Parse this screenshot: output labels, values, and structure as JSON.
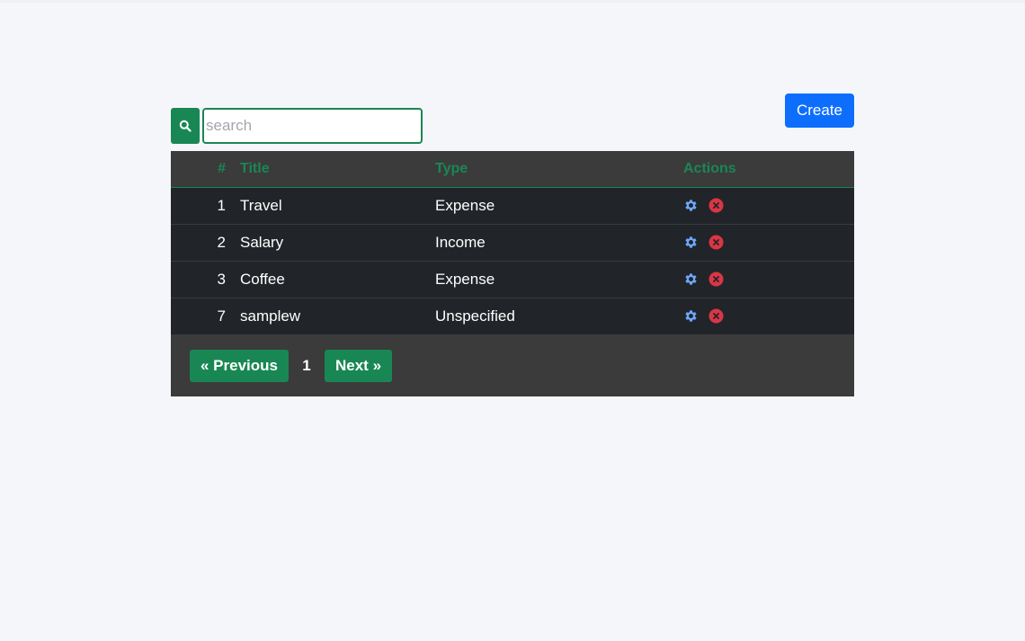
{
  "toolbar": {
    "create_label": "Create"
  },
  "search": {
    "placeholder": "search",
    "value": ""
  },
  "table": {
    "headers": {
      "num": "#",
      "title": "Title",
      "type": "Type",
      "actions": "Actions"
    },
    "rows": [
      {
        "num": "1",
        "title": "Travel",
        "type": "Expense"
      },
      {
        "num": "2",
        "title": "Salary",
        "type": "Income"
      },
      {
        "num": "3",
        "title": "Coffee",
        "type": "Expense"
      },
      {
        "num": "7",
        "title": "samplew",
        "type": "Unspecified"
      }
    ]
  },
  "pagination": {
    "prev_label": "« Previous",
    "current_page": "1",
    "next_label": "Next »"
  },
  "icons": {
    "search": "search-icon",
    "edit": "gear-icon",
    "delete": "close-circle-icon"
  },
  "colors": {
    "accent": "#198754",
    "primary": "#0d6efd",
    "danger": "#dc3545",
    "edit": "#6ea8fe"
  }
}
